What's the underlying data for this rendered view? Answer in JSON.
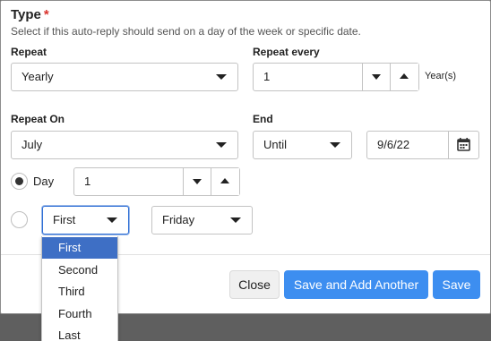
{
  "section": {
    "title": "Type",
    "required_mark": "*",
    "hint": "Select if this auto-reply should send on a day of the week or specific date."
  },
  "repeat": {
    "label": "Repeat",
    "value": "Yearly"
  },
  "repeat_every": {
    "label": "Repeat every",
    "value": "1",
    "unit": "Year(s)"
  },
  "repeat_on": {
    "label": "Repeat On",
    "value": "July"
  },
  "end": {
    "label": "End",
    "mode": "Until",
    "date": "9/6/22"
  },
  "day_option": {
    "label": "Day",
    "selected": true,
    "value": "1"
  },
  "weekday_option": {
    "selected": false,
    "ordinal": "First",
    "weekday": "Friday"
  },
  "ordinal_dropdown": {
    "options": [
      "First",
      "Second",
      "Third",
      "Fourth",
      "Last"
    ],
    "highlighted": "First"
  },
  "footer": {
    "close": "Close",
    "save_add": "Save and Add Another",
    "save": "Save"
  },
  "colors": {
    "primary": "#3d8ef0",
    "highlight": "#3e6fc5",
    "required": "#d9322c"
  },
  "icons": [
    "caret-down-icon",
    "caret-up-icon",
    "calendar-icon"
  ]
}
